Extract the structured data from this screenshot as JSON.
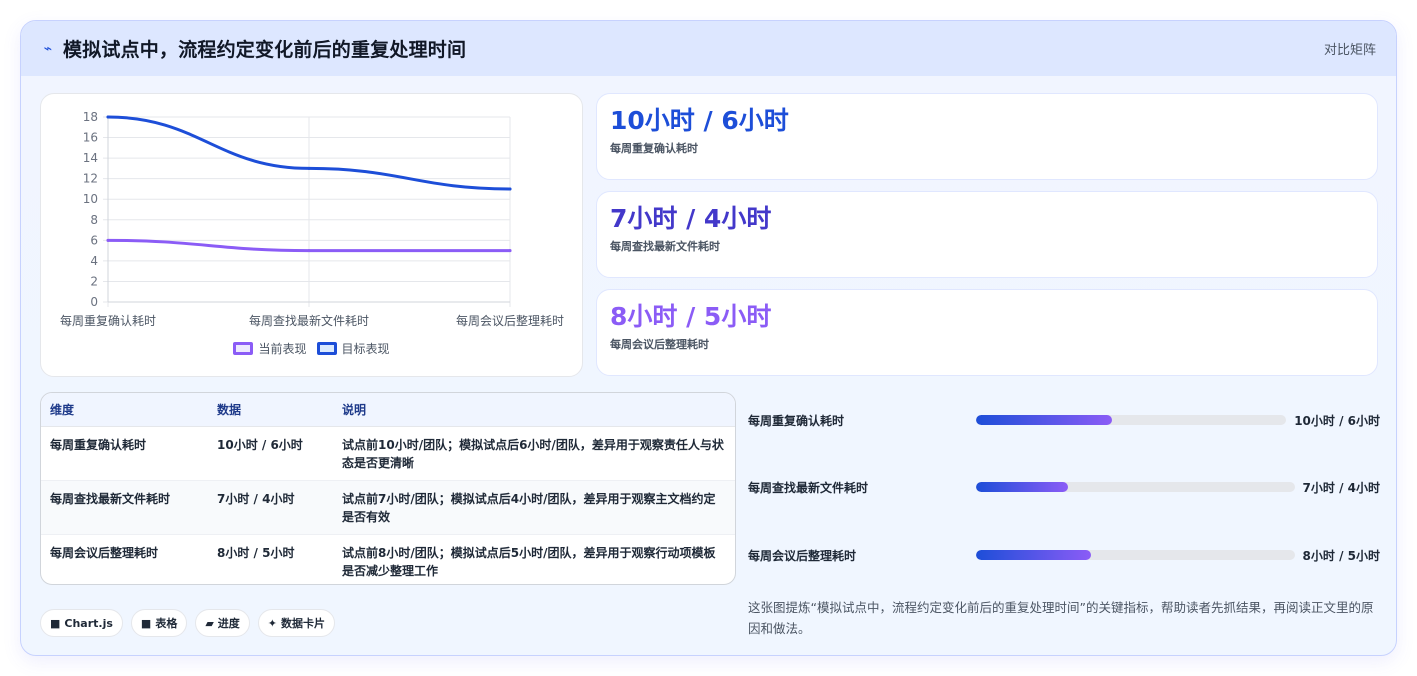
{
  "header": {
    "icon": "trend-line-icon",
    "title": "模拟试点中，流程约定变化前后的重复处理时间",
    "tag": "对比矩阵"
  },
  "chart_data": {
    "type": "line",
    "categories": [
      "每周重复确认耗时",
      "每周查找最新文件耗时",
      "每周会议后整理耗时"
    ],
    "series": [
      {
        "name": "当前表现",
        "values": [
          6,
          5,
          5
        ],
        "color": "#8b5cf6"
      },
      {
        "name": "目标表现",
        "values": [
          18,
          13,
          11
        ],
        "color": "#1d4ed8"
      }
    ],
    "ylim": [
      0,
      18
    ],
    "yticks": [
      "0",
      "2",
      "4",
      "6",
      "8",
      "10",
      "12",
      "14",
      "16",
      "18"
    ],
    "grid": true,
    "legend": "bottom"
  },
  "stats": [
    {
      "value": "10小时 / 6小时",
      "label": "每周重复确认耗时",
      "color": "#1d4ed8"
    },
    {
      "value": "7小时 / 4小时",
      "label": "每周查找最新文件耗时",
      "color": "#4338ca"
    },
    {
      "value": "8小时 / 5小时",
      "label": "每周会议后整理耗时",
      "color": "#8b5cf6"
    }
  ],
  "table": {
    "headers": [
      "维度",
      "数据",
      "说明"
    ],
    "rows": [
      {
        "dim": "每周重复确认耗时",
        "data": "10小时 / 6小时",
        "desc": "试点前10小时/团队；模拟试点后6小时/团队，差异用于观察责任人与状态是否更清晰"
      },
      {
        "dim": "每周查找最新文件耗时",
        "data": "7小时 / 4小时",
        "desc": "试点前7小时/团队；模拟试点后4小时/团队，差异用于观察主文档约定是否有效"
      },
      {
        "dim": "每周会议后整理耗时",
        "data": "8小时 / 5小时",
        "desc": "试点前8小时/团队；模拟试点后5小时/团队，差异用于观察行动项模板是否减少整理工作"
      }
    ]
  },
  "progress": [
    {
      "label": "每周重复确认耗时",
      "value": "10小时 / 6小时",
      "fill": 0.44
    },
    {
      "label": "每周查找最新文件耗时",
      "value": "7小时 / 4小时",
      "fill": 0.29
    },
    {
      "label": "每周会议后整理耗时",
      "value": "8小时 / 5小时",
      "fill": 0.36
    }
  ],
  "chips": [
    {
      "icon": "■",
      "label": "Chart.js"
    },
    {
      "icon": "■",
      "label": "表格"
    },
    {
      "icon": "▰",
      "label": "进度"
    },
    {
      "icon": "✦",
      "label": "数据卡片"
    }
  ],
  "summary": "这张图提炼“模拟试点中，流程约定变化前后的重复处理时间”的关键指标，帮助读者先抓结果，再阅读正文里的原因和做法。"
}
